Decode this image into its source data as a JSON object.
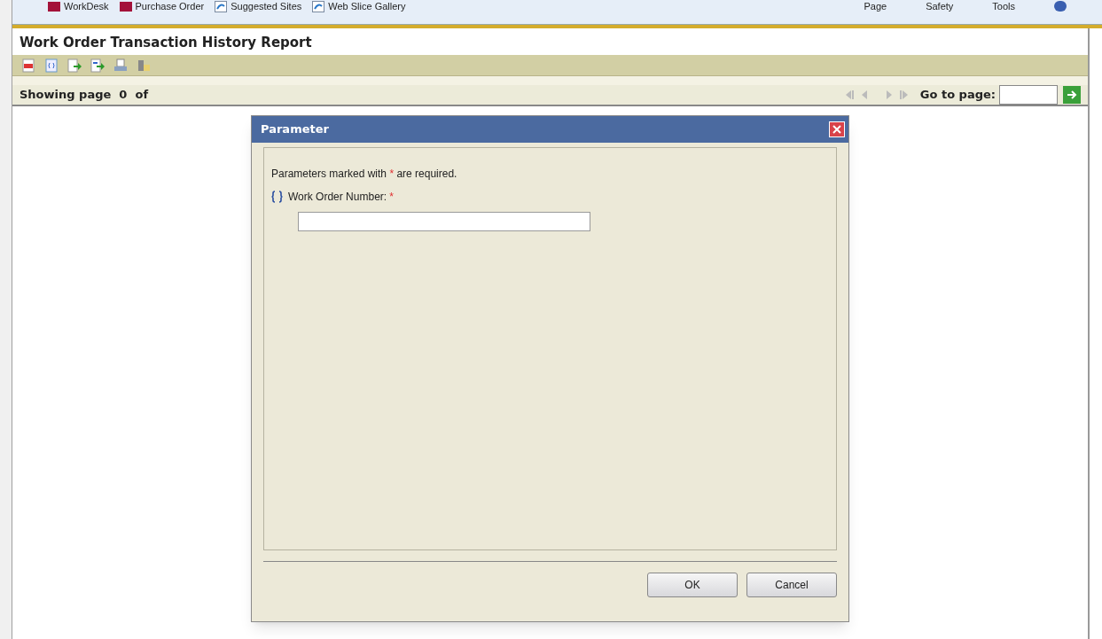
{
  "browser_bar": {
    "favorites": [
      {
        "label": "WorkDesk",
        "kind": "app"
      },
      {
        "label": "Purchase Order",
        "kind": "app"
      },
      {
        "label": "Suggested Sites",
        "kind": "web"
      },
      {
        "label": "Web Slice Gallery",
        "kind": "web"
      }
    ],
    "commands": [
      "Page",
      "Safety",
      "Tools"
    ]
  },
  "report": {
    "title": "Work Order Transaction History Report",
    "status": "Showing page  0  of",
    "goto_label": "Go to page:"
  },
  "dialog": {
    "title": "Parameter",
    "note": {
      "before": "Parameters marked with",
      "mark": "*",
      "after": "are required."
    },
    "fields": [
      {
        "label": "Work Order Number:",
        "required": true
      }
    ],
    "buttons": [
      "OK",
      "Cancel"
    ]
  }
}
